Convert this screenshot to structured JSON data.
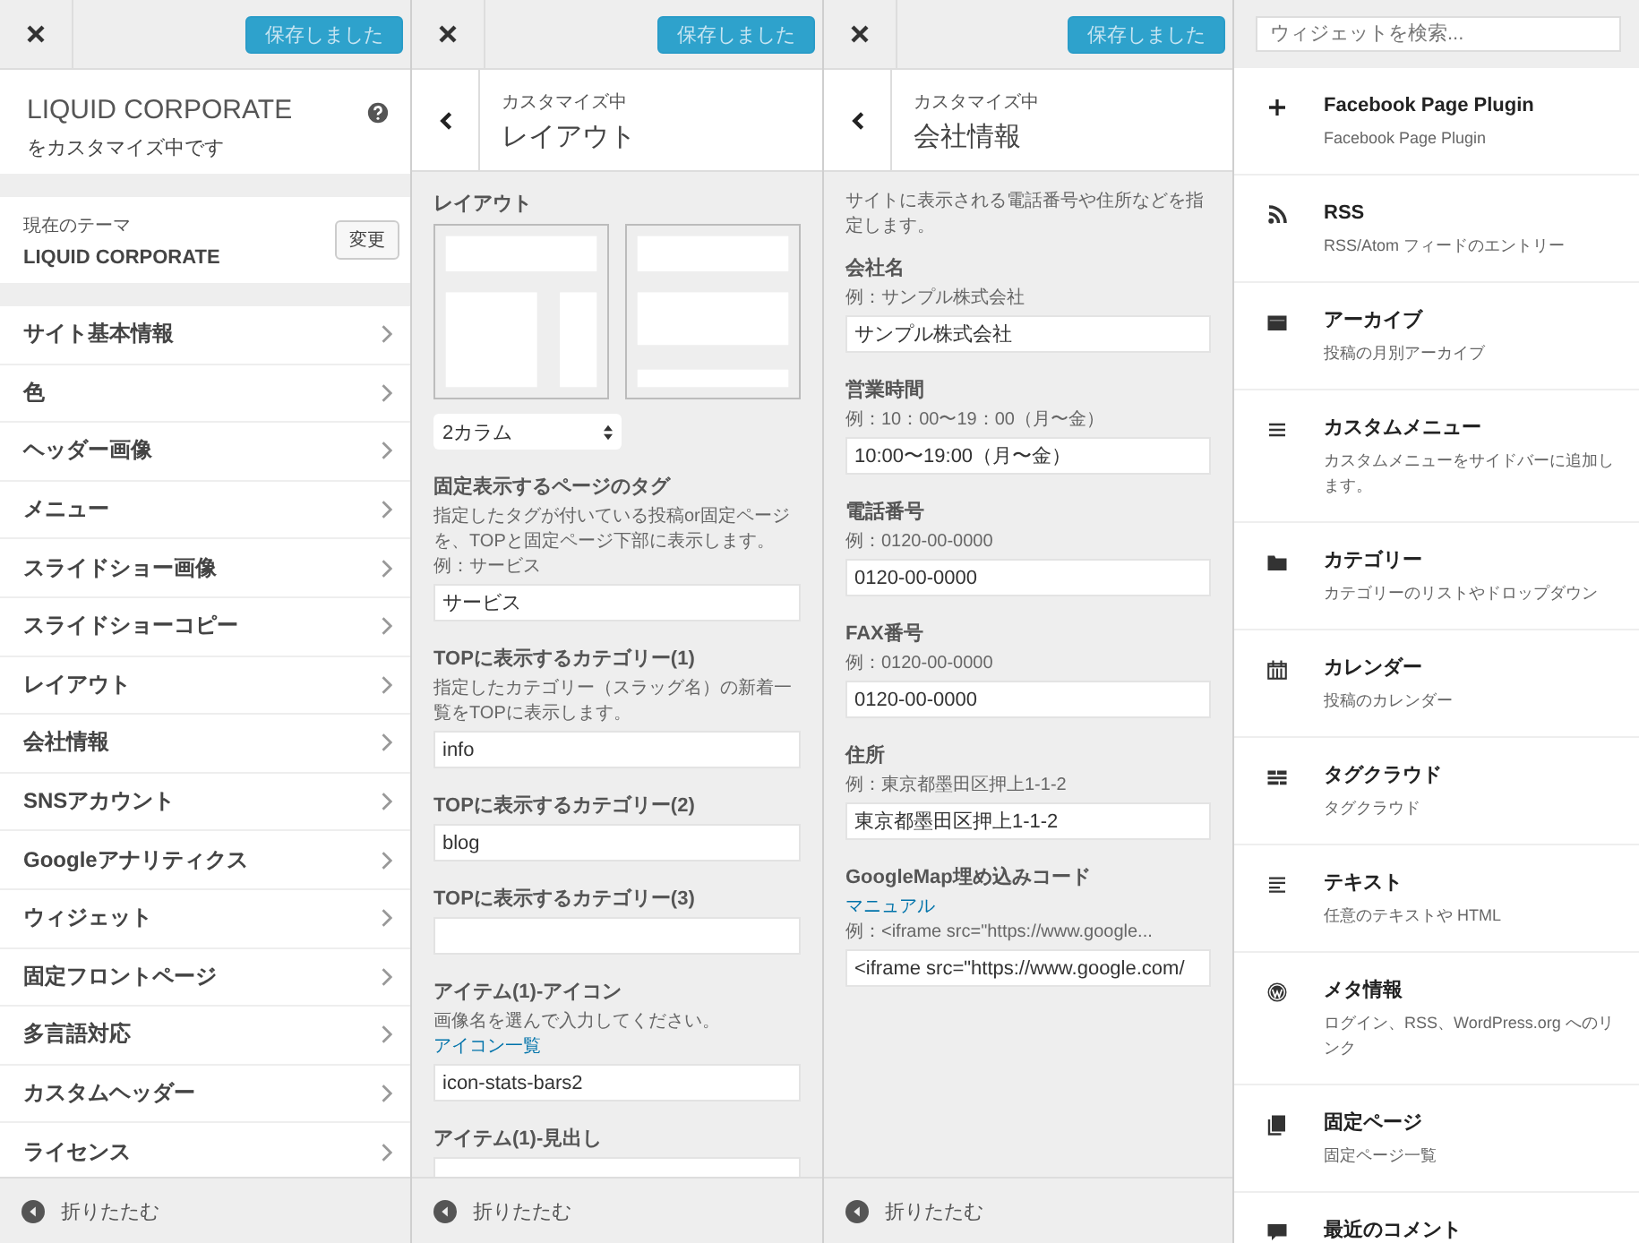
{
  "theme_panel": {
    "save_button": {
      "label": "保存しました",
      "saved": true
    },
    "title": "LIQUID CORPORATE",
    "subtitle": "をカスタマイズ中です",
    "current_theme": {
      "caption": "現在のテーマ",
      "name": "LIQUID CORPORATE",
      "change_button": "変更"
    },
    "menu": [
      "サイト基本情報",
      "色",
      "ヘッダー画像",
      "メニュー",
      "スライドショー画像",
      "スライドショーコピー",
      "レイアウト",
      "会社情報",
      "SNSアカウント",
      "Googleアナリティクス",
      "ウィジェット",
      "固定フロントページ",
      "多言語対応",
      "カスタムヘッダー",
      "ライセンス"
    ],
    "collapse": "折りたたむ"
  },
  "layout_panel": {
    "save_button": {
      "label": "保存しました",
      "saved": true
    },
    "breadcrumb": "カスタマイズ中",
    "title": "レイアウト",
    "controls": [
      {
        "kind": "layout_picker",
        "label": "レイアウト",
        "thumbnails": [
          {
            "kind": "sidebar"
          },
          {
            "kind": "full"
          }
        ],
        "select_value": "2カラム"
      },
      {
        "kind": "text",
        "label": "固定表示するページのタグ",
        "description": "指定したタグが付いている投稿or固定ページを、TOPと固定ページ下部に表示します。",
        "example": "例：サービス",
        "value": "サービス"
      },
      {
        "kind": "text",
        "label": "TOPに表示するカテゴリー(1)",
        "description": "指定したカテゴリー（スラッグ名）の新着一覧をTOPに表示します。",
        "value": "info"
      },
      {
        "kind": "text",
        "label": "TOPに表示するカテゴリー(2)",
        "value": "blog"
      },
      {
        "kind": "text",
        "label": "TOPに表示するカテゴリー(3)"
      },
      {
        "kind": "text",
        "label": "アイテム(1)-アイコン",
        "description": "画像名を選んで入力してください。",
        "link": "アイコン一覧",
        "value": "icon-stats-bars2"
      },
      {
        "kind": "text",
        "label": "アイテム(1)-見出し"
      }
    ],
    "collapse": "折りたたむ"
  },
  "company_panel": {
    "save_button": {
      "label": "保存しました",
      "saved": true
    },
    "breadcrumb": "カスタマイズ中",
    "title": "会社情報",
    "intro": "サイトに表示される電話番号や住所などを指定します。",
    "controls": [
      {
        "kind": "text",
        "label": "会社名",
        "example": "例：サンプル株式会社",
        "value": "サンプル株式会社"
      },
      {
        "kind": "text",
        "label": "営業時間",
        "example": "例：10：00〜19：00（月〜金）",
        "value": "10:00〜19:00（月〜金）"
      },
      {
        "kind": "text",
        "label": "電話番号",
        "example": "例：0120-00-0000",
        "value": "0120-00-0000"
      },
      {
        "kind": "text",
        "label": "FAX番号",
        "example": "例：0120-00-0000",
        "value": "0120-00-0000"
      },
      {
        "kind": "text",
        "label": "住所",
        "example": "例：東京都墨田区押上1-1-2",
        "value": "東京都墨田区押上1-1-2"
      },
      {
        "kind": "text",
        "label": "GoogleMap埋め込みコード",
        "link": "マニュアル",
        "example": "例：<iframe src=\"https://www.google...",
        "value": "<iframe src=\"https://www.google.com/"
      }
    ],
    "collapse": "折りたたむ"
  },
  "widget_panel": {
    "search": {
      "placeholder": "ウィジェットを検索..."
    },
    "widgets": [
      {
        "kind": "plus",
        "title": "Facebook Page Plugin",
        "description": "Facebook Page Plugin"
      },
      {
        "kind": "rss",
        "title": "RSS",
        "description": "RSS/Atom フィードのエントリー"
      },
      {
        "kind": "archive",
        "title": "アーカイブ",
        "description": "投稿の月別アーカイブ"
      },
      {
        "kind": "menu",
        "title": "カスタムメニュー",
        "description": "カスタムメニューをサイドバーに追加します。"
      },
      {
        "kind": "folder",
        "title": "カテゴリー",
        "description": "カテゴリーのリストやドロップダウン"
      },
      {
        "kind": "calendar",
        "title": "カレンダー",
        "description": "投稿のカレンダー"
      },
      {
        "kind": "tagcloud",
        "title": "タグクラウド",
        "description": "タグクラウド"
      },
      {
        "kind": "text",
        "title": "テキスト",
        "description": "任意のテキストや HTML"
      },
      {
        "kind": "circle",
        "title": "メタ情報",
        "description": "ログイン、RSS、WordPress.org へのリンク"
      },
      {
        "kind": "pages",
        "title": "固定ページ",
        "description": "固定ページ一覧"
      },
      {
        "kind": "comment",
        "title": "最近のコメント"
      }
    ]
  }
}
